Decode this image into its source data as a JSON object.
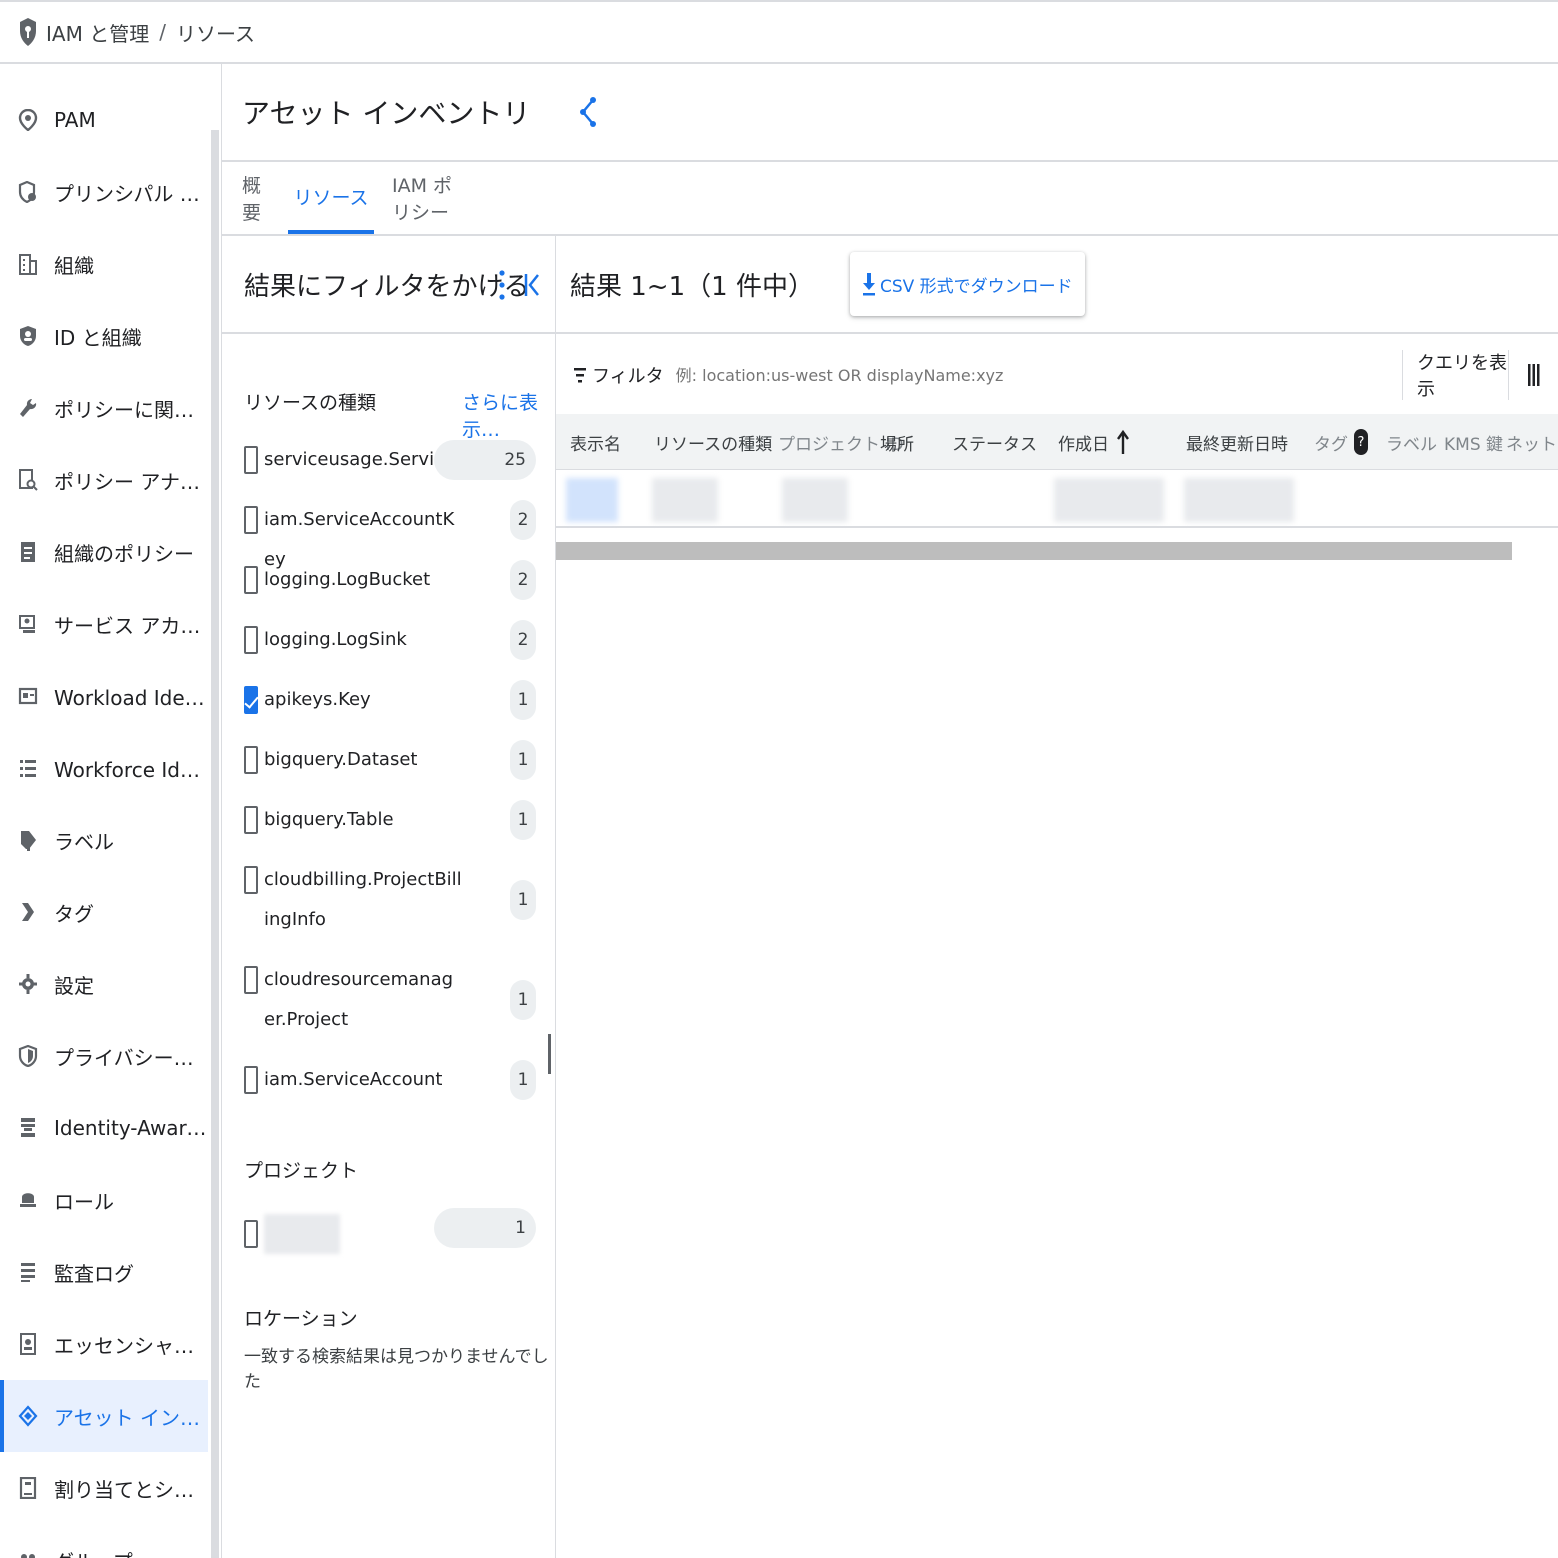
{
  "breadcrumb": {
    "section": "IAM と管理",
    "separator": "/",
    "page": "リソース"
  },
  "sidebar": {
    "items": [
      {
        "label": "PAM",
        "icon": "location-pin-icon"
      },
      {
        "label": "プリンシパル アクセス…",
        "icon": "lock-person-icon"
      },
      {
        "label": "組織",
        "icon": "building-icon"
      },
      {
        "label": "ID と組織",
        "icon": "shield-person-icon"
      },
      {
        "label": "ポリシーに関するトラ…",
        "icon": "wrench-icon"
      },
      {
        "label": "ポリシー アナライザ",
        "icon": "document-search-icon"
      },
      {
        "label": "組織のポリシー",
        "icon": "document-icon"
      },
      {
        "label": "サービス アカウント",
        "icon": "service-account-icon"
      },
      {
        "label": "Workload Identity 連携",
        "icon": "id-card-icon"
      },
      {
        "label": "Workforce Identity の連…",
        "icon": "list-icon"
      },
      {
        "label": "ラベル",
        "icon": "label-tag-icon"
      },
      {
        "label": "タグ",
        "icon": "tag-arrow-icon"
      },
      {
        "label": "設定",
        "icon": "gear-icon"
      },
      {
        "label": "プライバシーとセキュ…",
        "icon": "privacy-shield-icon"
      },
      {
        "label": "Identity-Aware Proxy",
        "icon": "proxy-icon"
      },
      {
        "label": "ロール",
        "icon": "role-hat-icon"
      },
      {
        "label": "監査ログ",
        "icon": "audit-list-icon"
      },
      {
        "label": "エッセンシャル コンタ…",
        "icon": "contact-card-icon"
      },
      {
        "label": "アセット インベントリ",
        "icon": "diamond-icon",
        "active": true
      },
      {
        "label": "割り当てとシステム上限",
        "icon": "quota-icon"
      },
      {
        "label": "グループ",
        "icon": "group-icon"
      }
    ]
  },
  "header": {
    "title": "アセット インベントリ"
  },
  "tabs": [
    {
      "label": "概要"
    },
    {
      "label": "リソース",
      "active": true
    },
    {
      "label": "IAM ポリシー"
    }
  ],
  "filters": {
    "title": "結果にフィルタをかける",
    "resource_type": {
      "title": "リソースの種類",
      "show_more": "さらに表示…",
      "options": [
        {
          "label": "serviceusage.Service",
          "count": "25",
          "checked": false
        },
        {
          "label": "iam.ServiceAccountKey",
          "count": "2",
          "checked": false
        },
        {
          "label": "logging.LogBucket",
          "count": "2",
          "checked": false
        },
        {
          "label": "logging.LogSink",
          "count": "2",
          "checked": false
        },
        {
          "label": "apikeys.Key",
          "count": "1",
          "checked": true
        },
        {
          "label": "bigquery.Dataset",
          "count": "1",
          "checked": false
        },
        {
          "label": "bigquery.Table",
          "count": "1",
          "checked": false
        },
        {
          "label": "cloudbilling.ProjectBillingInfo",
          "count": "1",
          "checked": false
        },
        {
          "label": "cloudresourcemanager.Project",
          "count": "1",
          "checked": false
        },
        {
          "label": "iam.ServiceAccount",
          "count": "1",
          "checked": false
        }
      ]
    },
    "project": {
      "title": "プロジェクト",
      "count": "1"
    },
    "location": {
      "title": "ロケーション",
      "empty_text": "一致する検索結果は見つかりませんでした"
    }
  },
  "results": {
    "count_text": "結果 1~1（1 件中）",
    "csv_label": "CSV 形式でダウンロード",
    "filter_label": "フィルタ",
    "filter_placeholder": "例: location:us-west OR displayName:xyz",
    "query_label": "クエリを表示",
    "columns": [
      "表示名",
      "リソースの種類",
      "プロジェクト ID",
      "場所",
      "ステータス",
      "作成日",
      "最終更新日時",
      "タグ",
      "ラベル",
      "KMS 鍵",
      "ネットワー"
    ],
    "sort_column": "作成日",
    "help_glyph": "?"
  },
  "colors": {
    "accent": "#1a73e8",
    "active_bg": "#e8f0fe",
    "divider": "#dadce0"
  }
}
